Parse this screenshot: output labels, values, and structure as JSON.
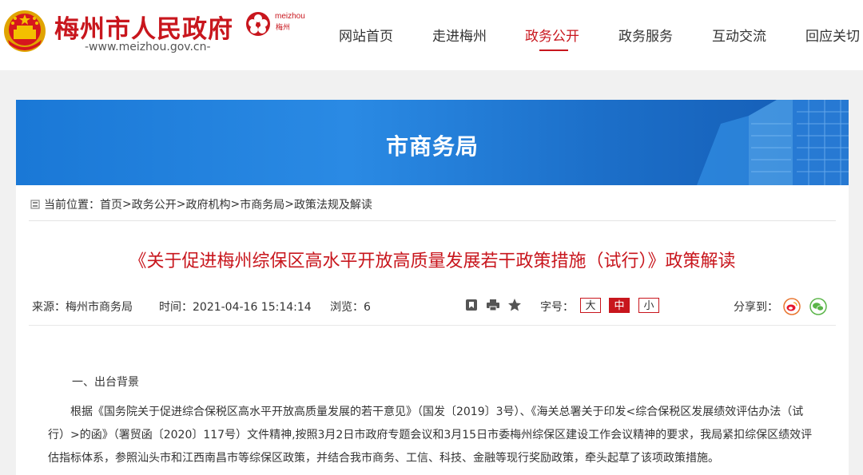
{
  "header": {
    "site_title": "梅州市人民政府",
    "site_url": "-www.meizhou.gov.cn-",
    "logo_text_en": "meizhou",
    "logo_text_cn": "梅州",
    "nav": [
      {
        "label": "网站首页"
      },
      {
        "label": "走进梅州"
      },
      {
        "label": "政务公开"
      },
      {
        "label": "政务服务"
      },
      {
        "label": "互动交流"
      },
      {
        "label": "回应关切"
      }
    ],
    "active_nav": "政务公开"
  },
  "banner": {
    "title": "市商务局"
  },
  "breadcrumb": {
    "prefix": "当前位置：",
    "items": [
      "首页",
      "政务公开",
      "政府机构",
      "市商务局",
      "政策法规及解读"
    ],
    "separator": " > "
  },
  "article": {
    "title": "《关于促进梅州综保区高水平开放高质量发展若干政策措施（试行）》政策解读",
    "source": "来源：梅州市商务局",
    "time": "时间：2021-04-16 15:14:14",
    "views": "浏览：6",
    "fontsize_label": "字号：",
    "fontsize_options": [
      "大",
      "中",
      "小"
    ],
    "fontsize_selected": "中",
    "share_label": "分享到：",
    "section_heading": "一、出台背景",
    "paragraph": "根据《国务院关于促进综合保税区高水平开放高质量发展的若干意见》（国发〔2019〕3号）、《海关总署关于印发<综合保税区发展绩效评估办法（试行）>的函》（署贸函〔2020〕117号）文件精神,按照3月2日市政府专题会议和3月15日市委梅州综保区建设工作会议精神的要求，我局紧扣综保区绩效评估指标体系，参照汕头市和江西南昌市等综保区政策，并结合我市商务、工信、科技、金融等现行奖励政策，牵头起草了该项政策措施。"
  },
  "colors": {
    "brand_red": "#c8161d",
    "banner_blue": "#1a78d6"
  },
  "icons": [
    "national-emblem-icon",
    "meizhou-logo-icon",
    "breadcrumb-location-icon",
    "bookmark-icon",
    "print-icon",
    "star-icon",
    "weibo-icon",
    "wechat-icon"
  ]
}
